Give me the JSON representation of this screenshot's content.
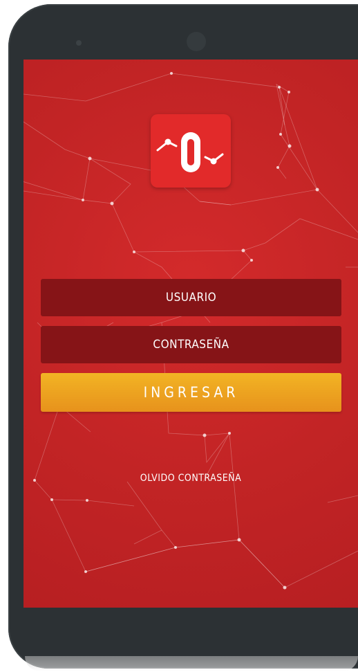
{
  "login": {
    "username_placeholder": "USUARIO",
    "password_placeholder": "CONTRASEÑA",
    "submit_label": "INGRESAR",
    "forgot_password_label": "OLVIDO CONTRASEÑA"
  },
  "logo": {
    "icon": "app-logo-icon"
  },
  "colors": {
    "background_red": "#c22425",
    "field_dark_red": "#861417",
    "button_orange": "#f2b424",
    "logo_red": "#e22a2a",
    "device_frame": "#2c3134"
  }
}
